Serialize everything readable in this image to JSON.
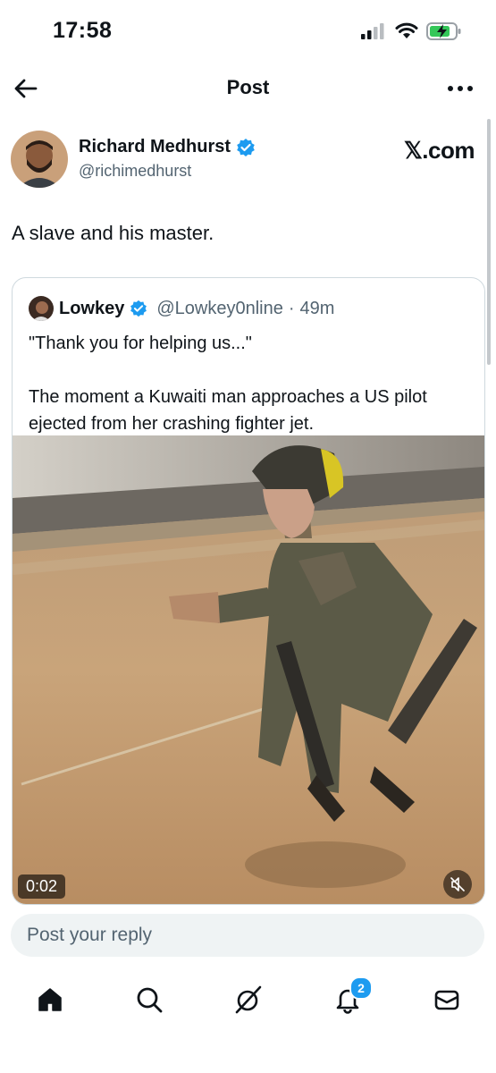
{
  "status_bar": {
    "time": "17:58"
  },
  "header": {
    "title": "Post"
  },
  "author": {
    "name": "Richard Medhurst",
    "handle": "@richimedhurst",
    "source_label": "𝕏.com"
  },
  "tweet": {
    "text": "A slave and his master."
  },
  "quoted": {
    "name": "Lowkey",
    "handle": "@Lowkey0nline",
    "separator": "·",
    "time_ago": "49m",
    "text": "\"Thank you for helping us...\"\n\nThe moment a Kuwaiti man approaches a US pilot ejected from her crashing fighter jet.",
    "video_duration": "0:02"
  },
  "reply": {
    "placeholder": "Post your reply"
  },
  "tabbar": {
    "notifications_badge": "2"
  },
  "colors": {
    "accent": "#1d9bf0",
    "text": "#0f1419",
    "secondary": "#536471"
  },
  "icons": [
    "back-arrow-icon",
    "more-icon",
    "verified-icon",
    "home-icon",
    "search-icon",
    "grok-icon",
    "bell-icon",
    "mail-icon",
    "mute-icon"
  ]
}
